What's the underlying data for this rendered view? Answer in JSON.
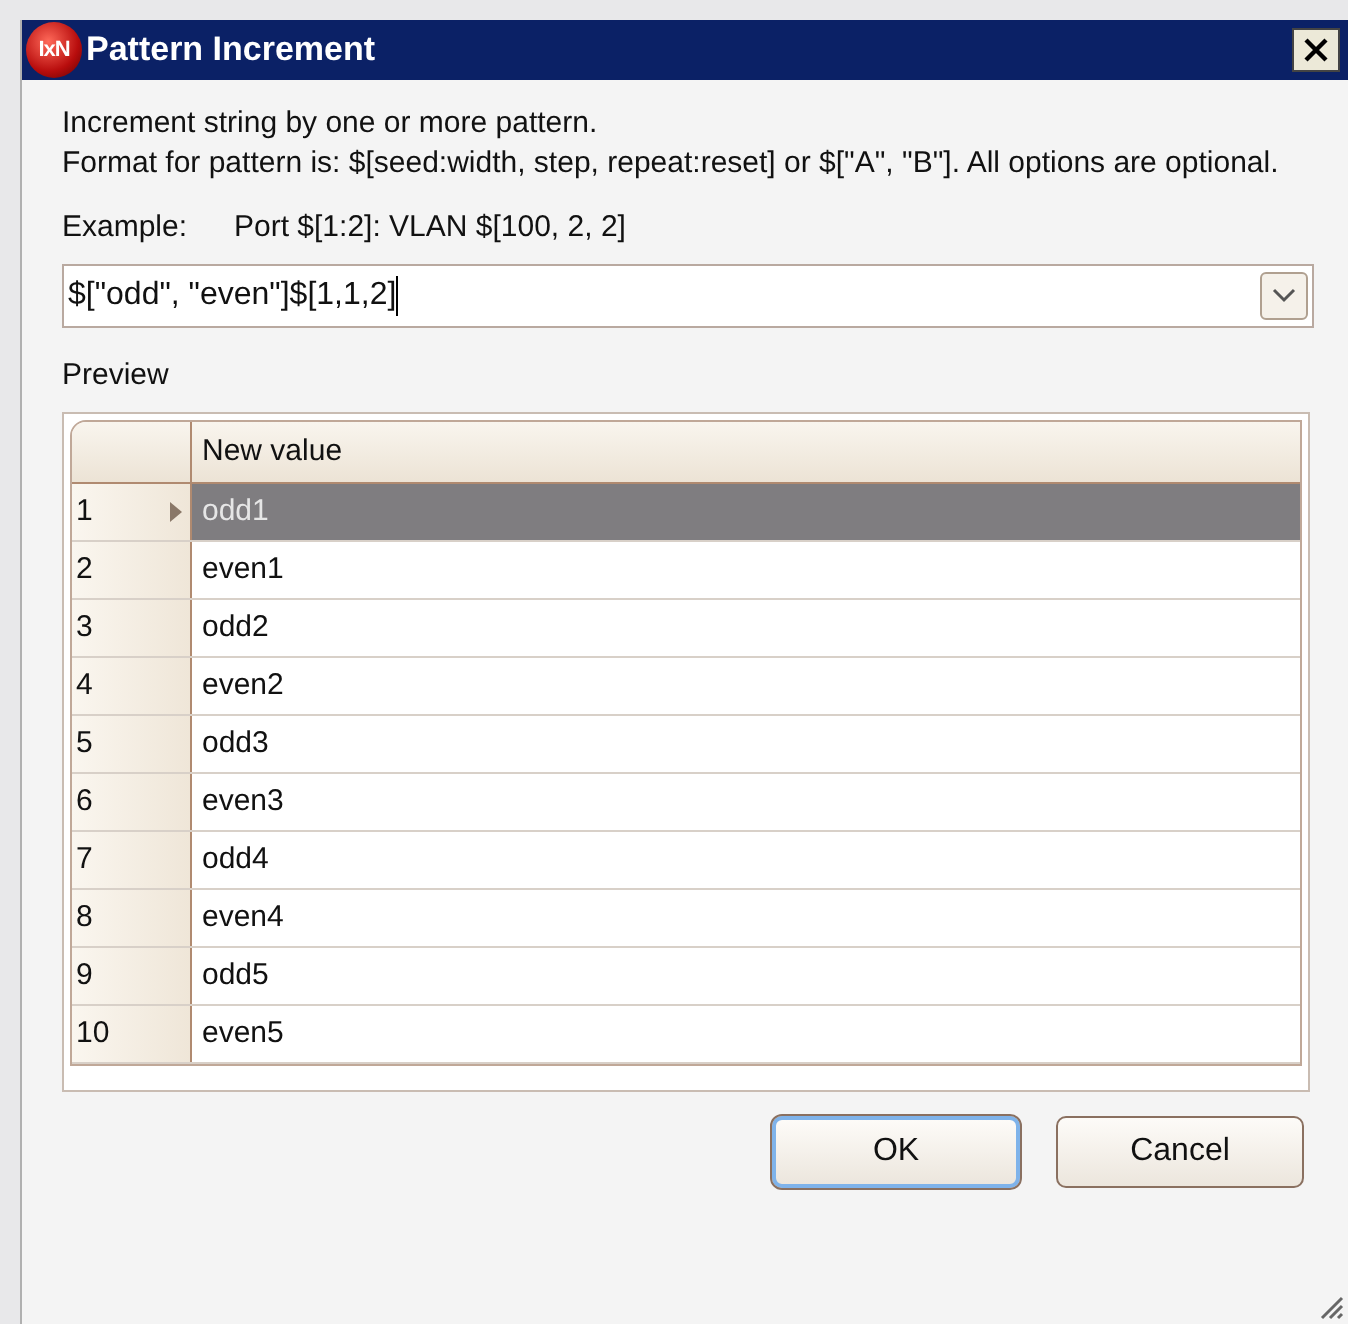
{
  "window": {
    "title": "Pattern Increment",
    "logo": "IxN"
  },
  "description": "Increment string by one or more pattern.\nFormat for pattern is: $[seed:width, step, repeat:reset] or $[\"A\", \"B\"]. All options are optional.",
  "example": {
    "label": "Example:",
    "value": "Port $[1:2]: VLAN $[100, 2, 2]"
  },
  "pattern_field": {
    "value": "$[\"odd\", \"even\"]$[1,1,2]"
  },
  "preview": {
    "label": "Preview",
    "columns": [
      "New value"
    ],
    "rows": [
      {
        "number": "1",
        "value": "odd1",
        "selected": true
      },
      {
        "number": "2",
        "value": "even1",
        "selected": false
      },
      {
        "number": "3",
        "value": "odd2",
        "selected": false
      },
      {
        "number": "4",
        "value": "even2",
        "selected": false
      },
      {
        "number": "5",
        "value": "odd3",
        "selected": false
      },
      {
        "number": "6",
        "value": "even3",
        "selected": false
      },
      {
        "number": "7",
        "value": "odd4",
        "selected": false
      },
      {
        "number": "8",
        "value": "even4",
        "selected": false
      },
      {
        "number": "9",
        "value": "odd5",
        "selected": false
      },
      {
        "number": "10",
        "value": "even5",
        "selected": false
      }
    ]
  },
  "buttons": [
    {
      "label": "OK",
      "focused": true
    },
    {
      "label": "Cancel",
      "focused": false
    }
  ]
}
